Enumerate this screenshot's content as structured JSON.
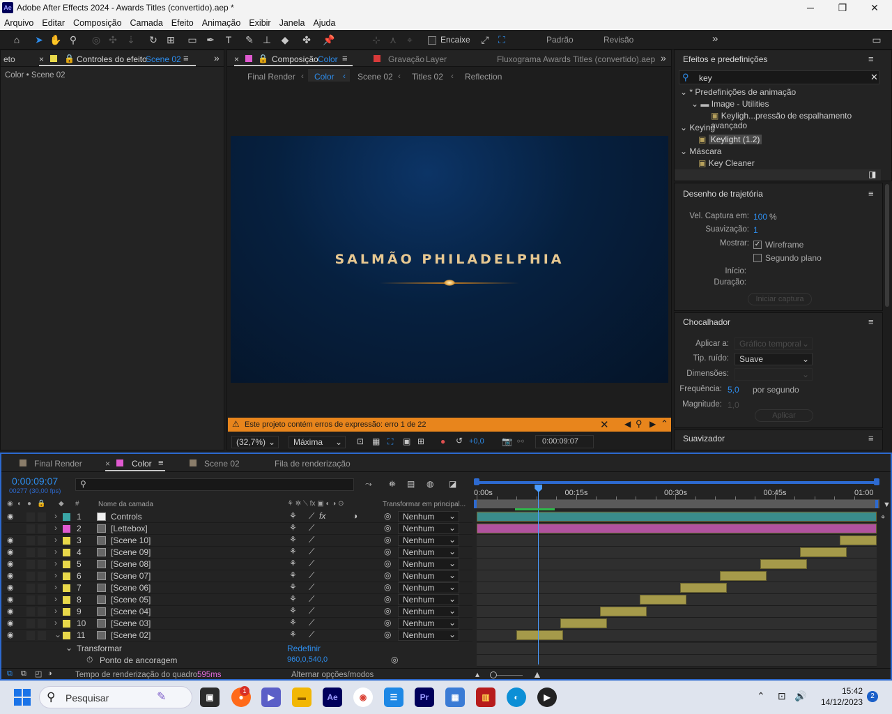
{
  "window": {
    "app_logo": "Ae",
    "title": "Adobe After Effects 2024 - Awards Titles (convertido).aep *",
    "minimize": "─",
    "maximize": "❐",
    "close": "✕"
  },
  "menu": [
    "Arquivo",
    "Editar",
    "Composição",
    "Camada",
    "Efeito",
    "Animação",
    "Exibir",
    "Janela",
    "Ajuda"
  ],
  "toolbar": {
    "snap_label": "Encaixe",
    "workspace_default": "Padrão",
    "workspace_review": "Revisão",
    "more": "»"
  },
  "effect_controls": {
    "left_tab_stub": "eto",
    "tab_label": "Controles do efeito",
    "tab_target": "Scene 02",
    "breadcrumb": "Color • Scene 02"
  },
  "composition": {
    "tab_label": "Composição",
    "tab_target": "Color",
    "footage_tab": "Gravação",
    "footage_target": "Layer",
    "flowchart_tab": "Fluxograma Awards Titles (convertido).aep",
    "breadcrumbs": [
      "Final Render",
      "Color",
      "Scene 02",
      "Titles 02",
      "Reflection"
    ],
    "preview_title": "SALMÃO PHILADELPHIA",
    "warning": "Este projeto contém erros de expressão: erro 1 de 22",
    "zoom": "(32,7%)",
    "resolution": "Máxima",
    "exposure": "+0,0",
    "timecode": "0:00:09:07"
  },
  "effects_presets": {
    "title": "Efeitos e predefinições",
    "search": "key",
    "tree": [
      {
        "label": "* Predefinições de animação",
        "level": 0,
        "type": "folder"
      },
      {
        "label": "Image - Utilities",
        "level": 1,
        "type": "folder"
      },
      {
        "label": "Keyligh...pressão de espalhamento avançado",
        "level": 2,
        "type": "preset"
      },
      {
        "label": "Keying",
        "level": 0,
        "type": "folder"
      },
      {
        "label": "Keylight (1.2)",
        "level": 1,
        "type": "effect",
        "selected": true
      },
      {
        "label": "Máscara",
        "level": 0,
        "type": "folder"
      },
      {
        "label": "Key Cleaner",
        "level": 1,
        "type": "effect"
      }
    ]
  },
  "motion_sketch": {
    "title": "Desenho de trajetória",
    "speed_label": "Vel. Captura em:",
    "speed_value": "100",
    "speed_unit": "%",
    "smoothing_label": "Suavização:",
    "smoothing_value": "1",
    "show_label": "Mostrar:",
    "wireframe": "Wireframe",
    "wireframe_checked": true,
    "background": "Segundo plano",
    "background_checked": false,
    "start_label": "Início:",
    "duration_label": "Duração:",
    "start_button": "Iniciar captura"
  },
  "wiggler": {
    "title": "Chocalhador",
    "apply_to_label": "Aplicar a:",
    "apply_to_value": "Gráfico temporal",
    "noise_label": "Tip. ruído:",
    "noise_value": "Suave",
    "dimensions_label": "Dimensões:",
    "frequency_label": "Frequência:",
    "frequency_value": "5,0",
    "frequency_unit": "por segundo",
    "magnitude_label": "Magnitude:",
    "magnitude_value": "1,0",
    "apply_button": "Aplicar"
  },
  "smoother": {
    "title": "Suavizador"
  },
  "timeline": {
    "tabs": [
      {
        "label": "Final Render",
        "color": "#8a7d6a"
      },
      {
        "label": "Color",
        "color": "#e05ad0"
      },
      {
        "label": "Scene 02",
        "color": "#8a7d6a"
      },
      {
        "label": "Fila de renderização",
        "color": ""
      }
    ],
    "timecode": "0:00:09:07",
    "frame_info": "00277 (30,00 fps)",
    "col_number": "#",
    "col_layer_name": "Nome da camada",
    "col_parent": "Transformar em principal...",
    "ruler": [
      "0:00s",
      "00:15s",
      "00:30s",
      "00:45s",
      "01:00"
    ],
    "layers": [
      {
        "num": "1",
        "name": "Controls",
        "color": "#3aa6a6",
        "icon": "solid-white",
        "parent": "Nenhum",
        "fx": true,
        "bar_color": "#3a8c8c",
        "bar_start": 0.0,
        "bar_end": 1.0
      },
      {
        "num": "2",
        "name": "[Lettebox]",
        "color": "#e05ad0",
        "icon": "comp",
        "parent": "Nenhum",
        "fx": false,
        "bar_color": "#b0529e",
        "bar_start": 0.0,
        "bar_end": 1.0
      },
      {
        "num": "3",
        "name": "[Scene 10]",
        "color": "#e8d84a",
        "icon": "comp",
        "parent": "Nenhum",
        "fx": false,
        "bar_color": "#a59a4a",
        "bar_start": 54.5,
        "bar_end": 60.0
      },
      {
        "num": "4",
        "name": "[Scene 09]",
        "color": "#e8d84a",
        "icon": "comp",
        "parent": "Nenhum",
        "fx": false,
        "bar_color": "#a59a4a",
        "bar_start": 48.5,
        "bar_end": 55.5
      },
      {
        "num": "5",
        "name": "[Scene 08]",
        "color": "#e8d84a",
        "icon": "comp",
        "parent": "Nenhum",
        "fx": false,
        "bar_color": "#a59a4a",
        "bar_start": 42.5,
        "bar_end": 49.5
      },
      {
        "num": "6",
        "name": "[Scene 07]",
        "color": "#e8d84a",
        "icon": "comp",
        "parent": "Nenhum",
        "fx": false,
        "bar_color": "#a59a4a",
        "bar_start": 36.5,
        "bar_end": 43.5
      },
      {
        "num": "7",
        "name": "[Scene 06]",
        "color": "#e8d84a",
        "icon": "comp",
        "parent": "Nenhum",
        "fx": false,
        "bar_color": "#a59a4a",
        "bar_start": 30.5,
        "bar_end": 37.5
      },
      {
        "num": "8",
        "name": "[Scene 05]",
        "color": "#e8d84a",
        "icon": "comp",
        "parent": "Nenhum",
        "fx": false,
        "bar_color": "#a59a4a",
        "bar_start": 24.5,
        "bar_end": 31.5
      },
      {
        "num": "9",
        "name": "[Scene 04]",
        "color": "#e8d84a",
        "icon": "comp",
        "parent": "Nenhum",
        "fx": false,
        "bar_color": "#a59a4a",
        "bar_start": 18.5,
        "bar_end": 25.5
      },
      {
        "num": "10",
        "name": "[Scene 03]",
        "color": "#e8d84a",
        "icon": "comp",
        "parent": "Nenhum",
        "fx": false,
        "bar_color": "#a59a4a",
        "bar_start": 12.5,
        "bar_end": 19.5
      },
      {
        "num": "11",
        "name": "[Scene 02]",
        "color": "#e8d84a",
        "icon": "comp",
        "parent": "Nenhum",
        "fx": false,
        "bar_color": "#a59a4a",
        "bar_start": 6.0,
        "bar_end": 13.0
      }
    ],
    "transform_label": "Transformar",
    "reset_label": "Redefinir",
    "anchor_label": "Ponto de ancoragem",
    "anchor_value": "960,0,540,0",
    "render_time_label": "Tempo de renderização do quadro:",
    "render_time_value": "595ms",
    "toggle_label": "Alternar opções/modos",
    "playhead_seconds": 9.23,
    "duration_seconds": 60
  },
  "taskbar": {
    "search_placeholder": "Pesquisar",
    "time": "15:42",
    "date": "14/12/2023",
    "notif_count": "2",
    "badge": "1"
  }
}
